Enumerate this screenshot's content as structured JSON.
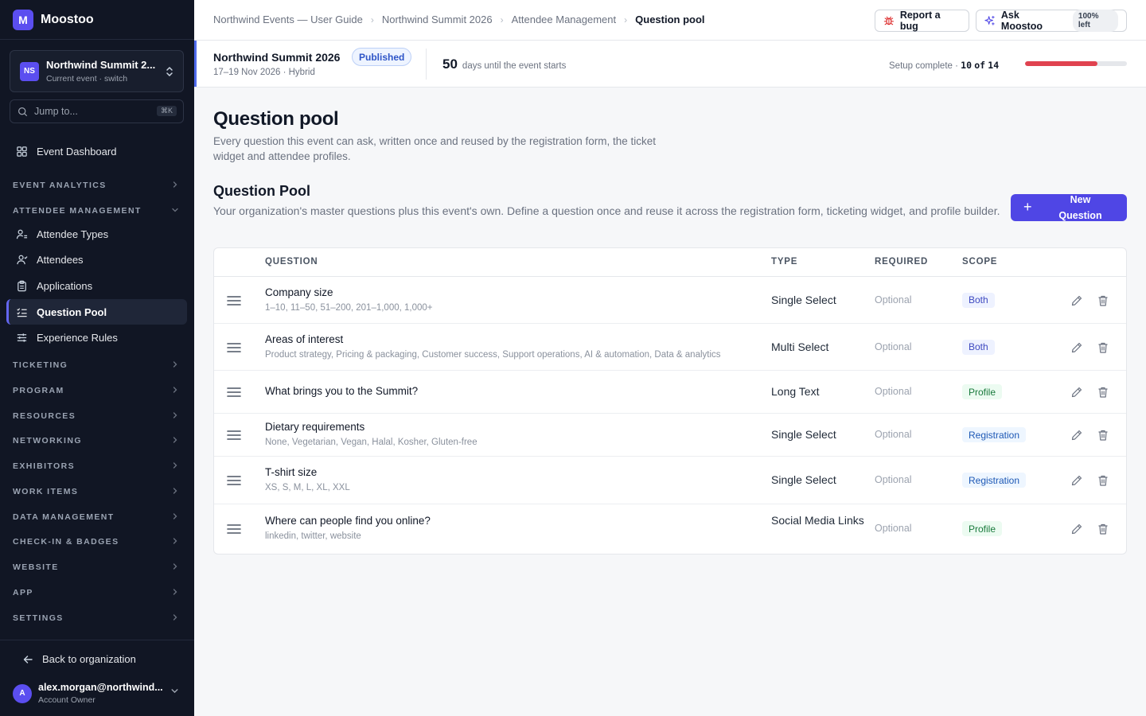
{
  "app": {
    "logo_letter": "M",
    "name": "Moostoo"
  },
  "event_switcher": {
    "badge": "NS",
    "name": "Northwind Summit 2...",
    "subtitle": "Current event · switch"
  },
  "jump": {
    "placeholder": "Jump to...",
    "shortcut": "⌘K"
  },
  "sidebar": {
    "dashboard": "Event Dashboard",
    "sections": {
      "event_analytics": "EVENT ANALYTICS",
      "attendee_management": "ATTENDEE MANAGEMENT",
      "ticketing": "TICKETING",
      "program": "PROGRAM",
      "resources": "RESOURCES",
      "networking": "NETWORKING",
      "exhibitors": "EXHIBITORS",
      "work_items": "WORK ITEMS",
      "data_management": "DATA MANAGEMENT",
      "checkin_badges": "CHECK-IN & BADGES",
      "website": "WEBSITE",
      "app": "APP",
      "settings": "SETTINGS"
    },
    "attendee_items": [
      "Attendee Types",
      "Attendees",
      "Applications",
      "Question Pool",
      "Experience Rules"
    ],
    "active_item": "Question Pool",
    "back": "Back to organization",
    "user": {
      "initial": "A",
      "email": "alex.morgan@northwind...",
      "role": "Account Owner"
    }
  },
  "breadcrumbs": [
    "Northwind Events — User Guide",
    "Northwind Summit 2026",
    "Attendee Management",
    "Question pool"
  ],
  "topbar": {
    "report_bug": "Report a bug",
    "ask": "Ask Moostoo",
    "quota": "100% left"
  },
  "event": {
    "name": "Northwind Summit 2026",
    "status": "Published",
    "dates": "17–19 Nov 2026 · Hybrid",
    "days_until": "50",
    "days_label": "days until the event starts",
    "setup_label": "Setup complete ·",
    "setup_done": "10",
    "setup_of": "of",
    "setup_total": "14",
    "setup_fraction": 0.714
  },
  "page": {
    "title": "Question pool",
    "description": "Every question this event can ask, written once and reused by the registration form, the ticket widget and attendee profiles."
  },
  "pool": {
    "title": "Question Pool",
    "description": "Your organization's master questions plus this event's own. Define a question once and reuse it across the registration form, ticketing widget, and profile builder.",
    "new_button": "New Question",
    "columns": {
      "question": "QUESTION",
      "type": "TYPE",
      "required": "REQUIRED",
      "scope": "SCOPE"
    },
    "rows": [
      {
        "title": "Company size",
        "options": "1–10, 11–50, 51–200, 201–1,000, 1,000+",
        "type": "Single Select",
        "required": "Optional",
        "scope": "Both"
      },
      {
        "title": "Areas of interest",
        "options": "Product strategy, Pricing & packaging, Customer success, Support operations, AI & automation, Data & analytics",
        "type": "Multi Select",
        "required": "Optional",
        "scope": "Both"
      },
      {
        "title": "What brings you to the Summit?",
        "options": "",
        "type": "Long Text",
        "required": "Optional",
        "scope": "Profile"
      },
      {
        "title": "Dietary requirements",
        "options": "None, Vegetarian, Vegan, Halal, Kosher, Gluten-free",
        "type": "Single Select",
        "required": "Optional",
        "scope": "Registration"
      },
      {
        "title": "T-shirt size",
        "options": "XS, S, M, L, XL, XXL",
        "type": "Single Select",
        "required": "Optional",
        "scope": "Registration"
      },
      {
        "title": "Where can people find you online?",
        "options": "linkedin, twitter, website",
        "type": "Social Media Links",
        "required": "Optional",
        "scope": "Profile"
      }
    ]
  },
  "colors": {
    "accent": "#4f46e5",
    "sidebar_bg": "#111624",
    "progress": "#e0424f",
    "published": "#2e55c7"
  },
  "icons": {
    "search": "search-icon",
    "dashboard": "grid-icon",
    "attendee_types": "user-tag-icon",
    "attendees": "user-icon",
    "applications": "clipboard-icon",
    "question_pool": "list-check-icon",
    "experience_rules": "sliders-icon",
    "bug": "bug-icon",
    "ask": "sparkle-icon",
    "drag": "drag-handle-icon",
    "edit": "pencil-icon",
    "delete": "trash-icon"
  }
}
